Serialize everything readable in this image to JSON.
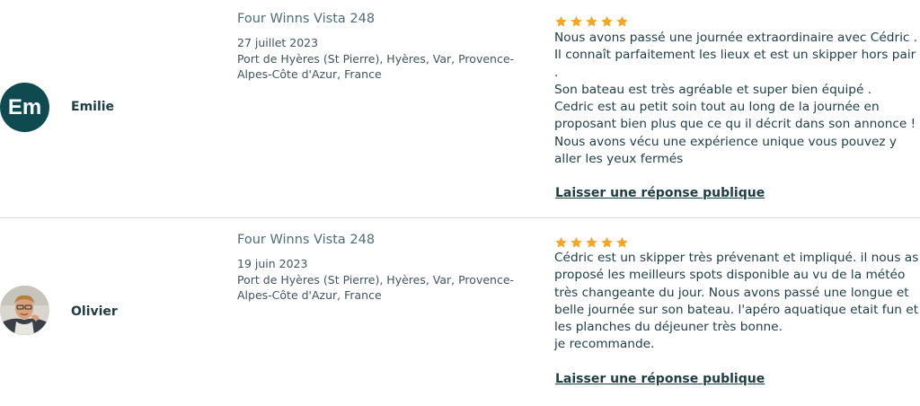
{
  "reviews": [
    {
      "avatar_initials": "Em",
      "avatar_color": "#0e4a4f",
      "user_name": "Emilie",
      "boat_name": "Four Winns Vista 248",
      "date": "27 juillet 2023",
      "location": "Port de Hyères (St Pierre), Hyères, Var, Provence-Alpes-Côte d'Azur, France",
      "rating": 5,
      "star_color": "#f5a623",
      "comment": "Nous avons passé une journée extraordinaire avec Cédric . Il connaît parfaitement les lieux et est un skipper hors pair .\nSon bateau est très agréable et super bien équipé .\nCedric est au petit soin tout au long de la journée en proposant bien plus que ce qu il décrit dans son annonce !\nNous avons vécu une expérience unique vous pouvez y aller les yeux fermés",
      "reply_label": "Laisser une réponse publique"
    },
    {
      "avatar_initials": "",
      "avatar_color": "",
      "user_name": "Olivier",
      "boat_name": "Four Winns Vista 248",
      "date": "19 juin 2023",
      "location": "Port de Hyères (St Pierre), Hyères, Var, Provence-Alpes-Côte d'Azur, France",
      "rating": 5,
      "star_color": "#f5a623",
      "comment": "Cédric est un skipper très prévenant et impliqué. il nous as proposé les meilleurs spots disponible au vu de la météo très changeante du jour. Nous avons passé une longue et belle journée sur son bateau. l'apéro aquatique etait fun et les planches du déjeuner très bonne.\nje recommande.",
      "reply_label": "Laisser une réponse publique"
    }
  ]
}
